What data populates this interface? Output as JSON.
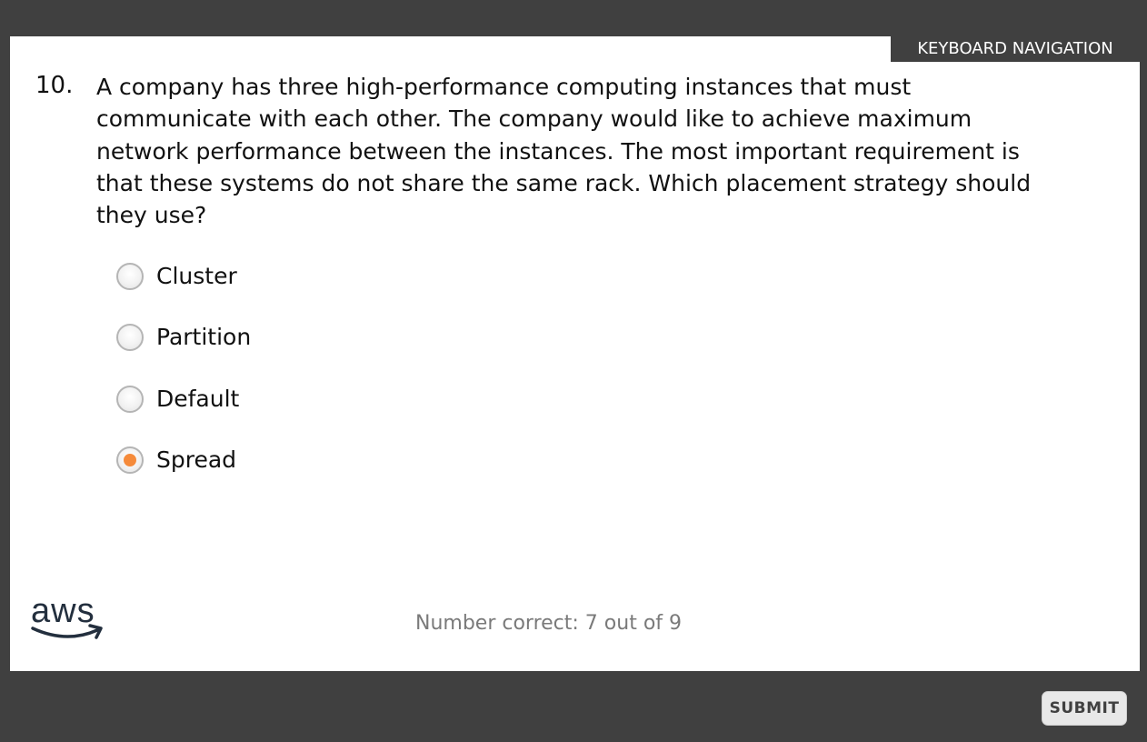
{
  "header": {
    "keyboard_nav_label": "KEYBOARD NAVIGATION"
  },
  "question": {
    "number": "10.",
    "text": "A company has three high-performance computing instances that must communicate with each other. The company would like to achieve maximum network performance between the instances. The most important requirement is that these systems do not share the same rack. Which placement strategy should they use?"
  },
  "options": [
    {
      "label": "Cluster",
      "selected": false
    },
    {
      "label": "Partition",
      "selected": false
    },
    {
      "label": "Default",
      "selected": false
    },
    {
      "label": "Spread",
      "selected": true
    }
  ],
  "footer": {
    "logo_text": "aws",
    "score_text": "Number correct: 7 out of 9",
    "submit_label": "SUBMIT"
  },
  "colors": {
    "frame": "#404040",
    "selected_radio": "#f58a3a",
    "score_text": "#7a7a7a"
  }
}
